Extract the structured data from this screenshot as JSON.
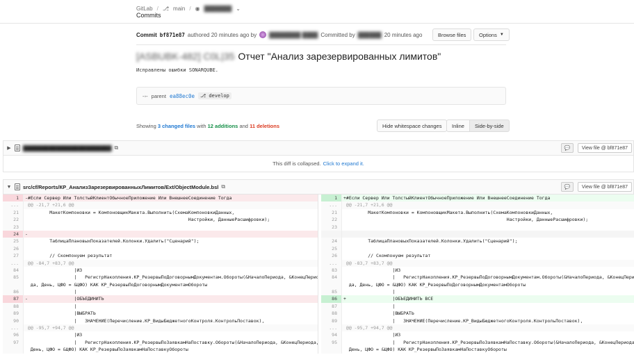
{
  "breadcrumb": {
    "items": [
      "GitLab",
      "main",
      "███████"
    ]
  },
  "page": {
    "title": "Commits"
  },
  "commit": {
    "label": "Commit",
    "sha": "bf871e87",
    "authored_text": "authored 20 minutes ago by",
    "author": "████████ ████",
    "committed_text": "Committed by",
    "committer": "██████",
    "committed_time": "20 minutes ago",
    "browse_files": "Browse files",
    "options": "Options",
    "title_blurred": "[ASBUBK-482] C0L|35",
    "title": "Отчет \"Анализ зарезервированных лимитов\"",
    "message": "Исправлены ошибки SONARQUBE.",
    "parent_label": "parent",
    "parent_sha": "ea88ec0e",
    "parent_branch": "develop"
  },
  "stats": {
    "showing": "Showing",
    "changed_files": "3 changed files",
    "with": "with",
    "additions": "12 additions",
    "and": "and",
    "deletions": "11 deletions"
  },
  "view_controls": {
    "hide_whitespace": "Hide whitespace changes",
    "inline": "Inline",
    "side_by_side": "Side-by-side"
  },
  "files": [
    {
      "path": "████████████████████████",
      "view_file": "View file @ bf871e87",
      "collapsed_msg": "This diff is collapsed.",
      "expand_link": "Click to expand it."
    },
    {
      "path": "src/cf/Reports/КР_АнализЗарезервированныхЛимитов/Ext/ObjectModule.bsl",
      "view_file": "View file @ bf871e87"
    }
  ],
  "diff": {
    "left": [
      {
        "type": "old",
        "num": "1",
        "code": "-#Если Сервер Или ТолстыйКлиентОбычноеПриложение Или ВнешнееСоединение Тогда"
      },
      {
        "type": "match",
        "num": "...",
        "code": " @@ -21,7 +21,6 @@"
      },
      {
        "type": "ctx",
        "num": "21",
        "code": "         МакетКомпоновки = КомпоновщикМакета.Выполнить(СхемаКомпоновкиДанных,"
      },
      {
        "type": "ctx",
        "num": "22",
        "code": "                                                            Настройки, ДанныеРасшифровки);"
      },
      {
        "type": "ctx",
        "num": "23",
        "code": ""
      },
      {
        "type": "old",
        "num": "24",
        "code": "-"
      },
      {
        "type": "ctx",
        "num": "25",
        "code": "         ТаблицаПлановыхПоказателей.Колонки.Удалить(\"Сценарий\");"
      },
      {
        "type": "ctx",
        "num": "26",
        "code": ""
      },
      {
        "type": "ctx",
        "num": "27",
        "code": "         // Скомпонуем результат"
      },
      {
        "type": "match",
        "num": "...",
        "code": " @@ -84,7 +83,7 @@"
      },
      {
        "type": "ctx",
        "num": "84",
        "code": "                  |ИЗ"
      },
      {
        "type": "ctx",
        "num": "85",
        "code": "                  |   РегистрНакопления.КР_РезервыПоДоговорнымДокументам.Обороты(&НачалоПериода, &КонецПерио"
      },
      {
        "type": "ctx",
        "num": "",
        "code": "  да, День, ЦФО = &ЦФО) КАК КР_РезервыПоДоговорнымДокументамОбороты"
      },
      {
        "type": "ctx",
        "num": "86",
        "code": "                  |"
      },
      {
        "type": "old",
        "num": "87",
        "code": "-                 |ОБЪЕДИНИТЬ"
      },
      {
        "type": "ctx",
        "num": "88",
        "code": "                  |"
      },
      {
        "type": "ctx",
        "num": "89",
        "code": "                  |ВЫБРАТЬ"
      },
      {
        "type": "ctx",
        "num": "90",
        "code": "                  |   ЗНАЧЕНИЕ(Перечисление.КР_ВидыБюджетногоКонтроля.КонтрольПоставок),"
      },
      {
        "type": "match",
        "num": "...",
        "code": " @@ -95,7 +94,7 @@"
      },
      {
        "type": "ctx",
        "num": "96",
        "code": "                  |ИЗ"
      },
      {
        "type": "ctx",
        "num": "97",
        "code": "                  |   РегистрНакопления.КР_РезервыПоЗаявкамНаПоставку.Обороты(&НачалоПериода, &КонецПериода,"
      },
      {
        "type": "ctx",
        "num": "",
        "code": "  День, ЦФО = &ЦФО) КАК КР_РезервыПоЗаявкамНаПоставкуОбороты"
      }
    ],
    "right": [
      {
        "type": "new",
        "num": "1",
        "code": "+#Если Сервер Или ТолстыйКлиентОбычноеПриложение Или ВнешнееСоединение Тогда"
      },
      {
        "type": "match",
        "num": "...",
        "code": " @@ -21,7 +21,6 @@"
      },
      {
        "type": "ctx",
        "num": "21",
        "code": "         МакетКомпоновки = КомпоновщикМакета.Выполнить(СхемаКомпоновкиДанных,"
      },
      {
        "type": "ctx",
        "num": "22",
        "code": "                                                            Настройки, ДанныеРасшифровки);"
      },
      {
        "type": "ctx",
        "num": "23",
        "code": ""
      },
      {
        "type": "empty",
        "num": "",
        "code": ""
      },
      {
        "type": "ctx",
        "num": "24",
        "code": "         ТаблицаПлановыхПоказателей.Колонки.Удалить(\"Сценарий\");"
      },
      {
        "type": "ctx",
        "num": "25",
        "code": ""
      },
      {
        "type": "ctx",
        "num": "26",
        "code": "         // Скомпонуем результат"
      },
      {
        "type": "match",
        "num": "...",
        "code": " @@ -83,7 +83,7 @@"
      },
      {
        "type": "ctx",
        "num": "83",
        "code": "                  |ИЗ"
      },
      {
        "type": "ctx",
        "num": "84",
        "code": "                  |   РегистрНакопления.КР_РезервыПоДоговорнымДокументам.Обороты(&НачалоПериода, &КонецПерио"
      },
      {
        "type": "ctx",
        "num": "",
        "code": "  да, День, ЦФО = &ЦФО) КАК КР_РезервыПоДоговорнымДокументамОбороты"
      },
      {
        "type": "ctx",
        "num": "85",
        "code": "                  |"
      },
      {
        "type": "new",
        "num": "86",
        "code": "+                 |ОБЪЕДИНИТЬ ВСЕ"
      },
      {
        "type": "ctx",
        "num": "87",
        "code": "                  |"
      },
      {
        "type": "ctx",
        "num": "88",
        "code": "                  |ВЫБРАТЬ"
      },
      {
        "type": "ctx",
        "num": "89",
        "code": "                  |   ЗНАЧЕНИЕ(Перечисление.КР_ВидыБюджетногоКонтроля.КонтрольПоставок),"
      },
      {
        "type": "match",
        "num": "...",
        "code": " @@ -95,7 +94,7 @@"
      },
      {
        "type": "ctx",
        "num": "94",
        "code": "                  |ИЗ"
      },
      {
        "type": "ctx",
        "num": "95",
        "code": "                  |   РегистрНакопления.КР_РезервыПоЗаявкамНаПоставку.Обороты(&НачалоПериода, &КонецПериода,"
      },
      {
        "type": "ctx",
        "num": "",
        "code": "  День, ЦФО = &ЦФО) КАК КР_РезервыПоЗаявкамНаПоставкуОбороты"
      }
    ]
  }
}
